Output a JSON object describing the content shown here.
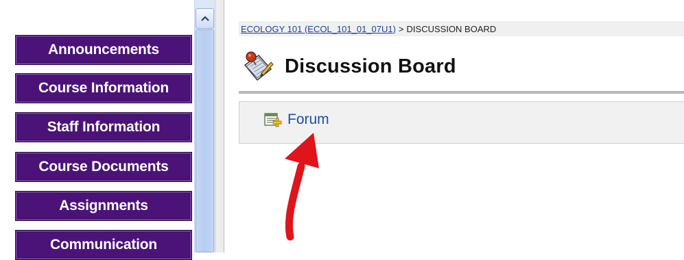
{
  "sidebar": {
    "items": [
      {
        "label": "Announcements"
      },
      {
        "label": "Course Information"
      },
      {
        "label": "Staff Information"
      },
      {
        "label": "Course Documents"
      },
      {
        "label": "Assignments"
      },
      {
        "label": "Communication"
      }
    ]
  },
  "breadcrumb": {
    "course_link": "ECOLOGY 101 (ECOL_101_01_07U1)",
    "separator": ">",
    "current": "DISCUSSION BOARD"
  },
  "page": {
    "title": "Discussion Board",
    "title_icon": "discussion-board-icon"
  },
  "forum": {
    "label": "Forum",
    "icon": "add-forum-icon"
  },
  "colors": {
    "menu_button_bg": "#4b1378",
    "link": "#1f4ea8",
    "arrow": "#e0141b"
  }
}
